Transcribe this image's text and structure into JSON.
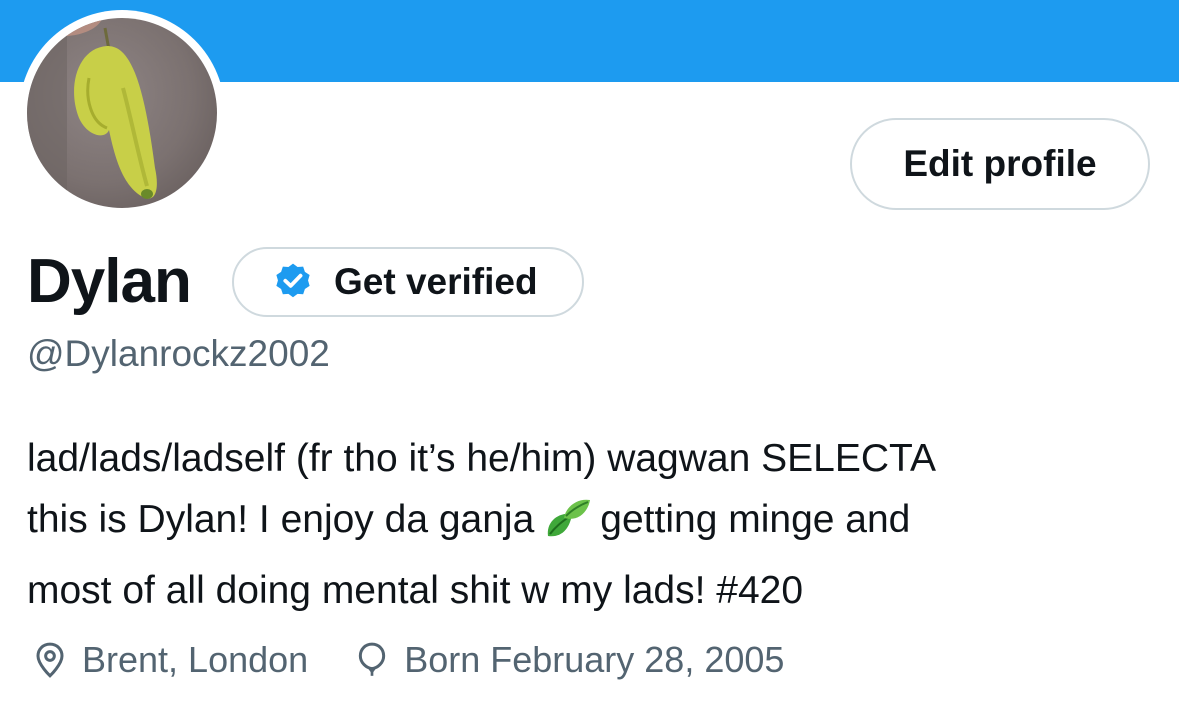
{
  "header": {
    "banner_color": "#1d9bf0"
  },
  "profile": {
    "avatar_icon": "avatar-photo",
    "display_name": "Dylan",
    "handle": "@Dylanrockz2002",
    "edit_button_label": "Edit profile",
    "verify_button_label": "Get verified",
    "verify_icon": "verified-badge-icon",
    "bio": {
      "line1": "lad/lads/ladself (fr tho it’s he/him) wagwan SELECTA",
      "line2_before": "this is Dylan! I enjoy da ganja",
      "line2_emoji": "leaf-emoji-icon",
      "line2_after": "getting minge and",
      "line3": "most of all doing mental shit w my lads! #420"
    },
    "location": "Brent, London",
    "location_icon": "location-pin-icon",
    "birthday": "Born February 28, 2005",
    "birthday_icon": "balloon-icon"
  },
  "colors": {
    "accent": "#1d9bf0",
    "text_primary": "#0f1419",
    "text_secondary": "#536471",
    "border": "#cfd9de"
  }
}
